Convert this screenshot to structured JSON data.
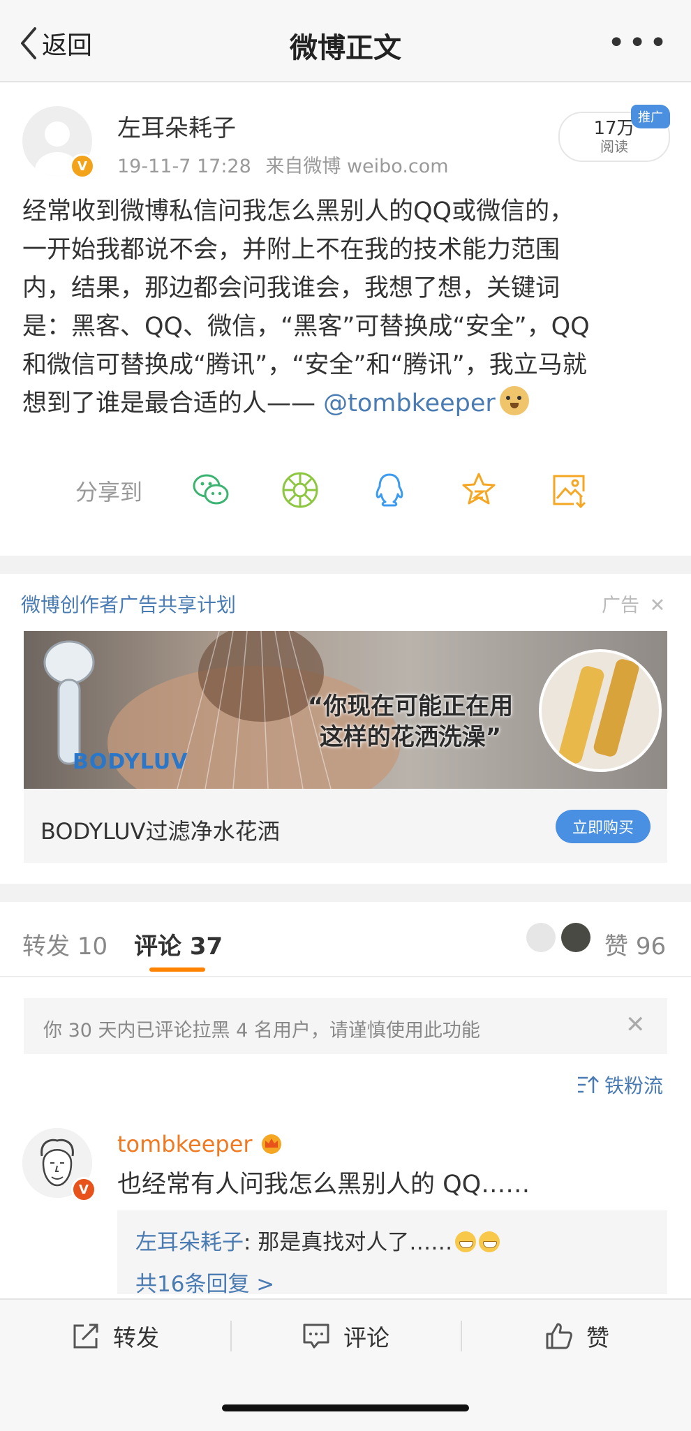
{
  "nav": {
    "back_label": "返回",
    "title": "微博正文"
  },
  "post": {
    "username": "左耳朵耗子",
    "time": "19-11-7 17:28",
    "source": "来自微博 weibo.com",
    "reads_count": "17万",
    "reads_label": "阅读",
    "promo_badge": "推广",
    "verified_badge": "V",
    "content_lines": [
      "经常收到微博私信问我怎么黑别人的QQ或微信的，",
      "一开始我都说不会，并附上不在我的技术能力范围",
      "内，结果，那边都会问我谁会，我想了想，关键词",
      "是：黑客、QQ、微信，“黑客”可替换成“安全”，QQ",
      "和微信可替换成“腾讯”，“安全”和“腾讯”，我立马就"
    ],
    "content_last_prefix": "想到了谁是最合适的人—— ",
    "mention": "@tombkeeper",
    "share_label": "分享到",
    "share_icons": [
      "wechat-icon",
      "moments-icon",
      "qq-icon",
      "favorite-star-icon",
      "save-image-icon"
    ]
  },
  "ad": {
    "plan_label": "微博创作者广告共享计划",
    "ad_tag": "广告",
    "slogan_line1": "“你现在可能正在用",
    "slogan_line2": "这样的花洒洗澡”",
    "brand": "BODYLUV",
    "product_name": "BODYLUV过滤净水花洒",
    "buy_label": "立即购买"
  },
  "tabs": {
    "repost_label": "转发",
    "repost_count": "10",
    "comment_label": "评论",
    "comment_count": "37",
    "like_label": "赞",
    "like_count": "96"
  },
  "notice": {
    "text": "你 30 天内已评论拉黑 4 名用户，请谨慎使用此功能"
  },
  "sort": {
    "label": "铁粉流"
  },
  "comment": {
    "username": "tombkeeper",
    "text": "也经常有人问我怎么黑别人的 QQ……",
    "reply_author": "左耳朵耗子",
    "reply_text": ": 那是真找对人了……",
    "reply_more": "共16条回复 >"
  },
  "bottom_bar": {
    "repost": "转发",
    "comment": "评论",
    "like": "赞"
  },
  "colors": {
    "link": "#4a7cb3",
    "accent_orange": "#ff8200",
    "vip_orange": "#ef7a22",
    "button_blue": "#4a90e2"
  }
}
